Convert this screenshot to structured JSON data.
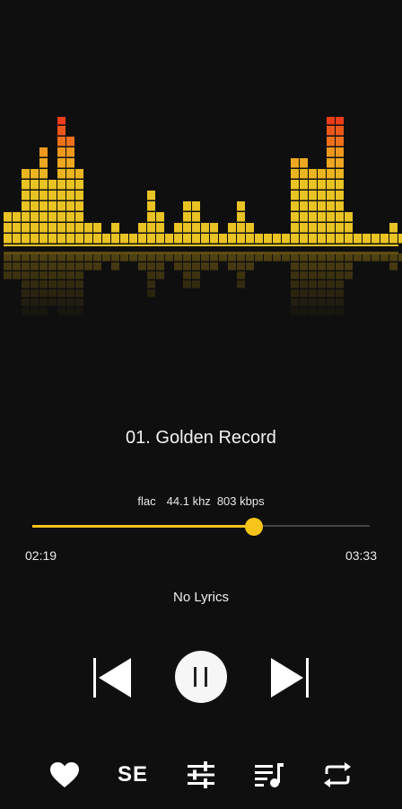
{
  "visualizer": {
    "bands": [
      3,
      3,
      7,
      7,
      9,
      6,
      13,
      10,
      7,
      2,
      2,
      1,
      2,
      1,
      1,
      2,
      5,
      3,
      1,
      2,
      4,
      4,
      2,
      2,
      1,
      2,
      4,
      2,
      1,
      1,
      1,
      1,
      8,
      8,
      7,
      7,
      13,
      13,
      3,
      1,
      1,
      1,
      1,
      2,
      1,
      1
    ],
    "colors": {
      "low": "#e9c323",
      "mid": "#f08a1c",
      "high": "#e8231a"
    }
  },
  "track": {
    "title": "01. Golden Record"
  },
  "audio_info": {
    "format": "flac",
    "sample_rate": "44.1 khz",
    "bitrate": "803 kbps"
  },
  "playback": {
    "elapsed": "02:19",
    "total": "03:33",
    "progress": 0.657
  },
  "lyrics": {
    "status": "No Lyrics"
  },
  "controls": {
    "previous": "skip-previous-icon",
    "play_pause": "pause-icon",
    "next": "skip-next-icon"
  },
  "bottom_bar": {
    "favorite": "heart-icon",
    "sound_effects_label": "SE",
    "equalizer": "equalizer-sliders-icon",
    "playlist": "playlist-icon",
    "repeat": "repeat-icon"
  },
  "accent_color": "#f6c41a"
}
